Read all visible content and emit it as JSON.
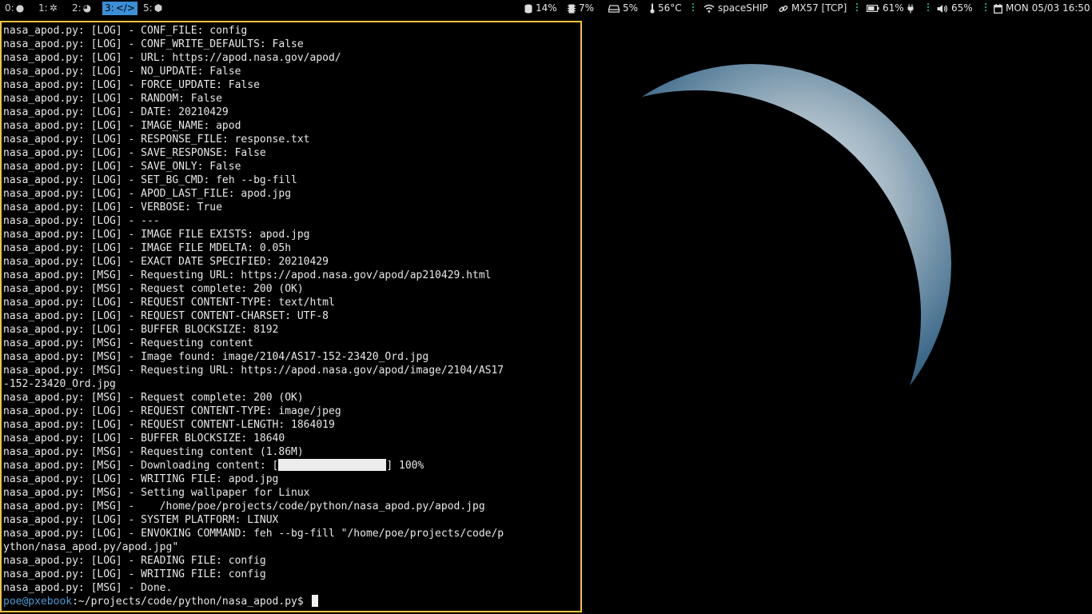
{
  "workspaces": [
    {
      "label": "0:",
      "icon": "bomb-icon",
      "active": false
    },
    {
      "label": "1:",
      "icon": "gear-icon",
      "active": false
    },
    {
      "label": "2:",
      "icon": "firefox-icon",
      "active": false
    },
    {
      "label": "3:",
      "icon": "code-icon",
      "active": true
    },
    {
      "label": "5:",
      "icon": "box-icon",
      "active": false
    }
  ],
  "status": {
    "disk": "14%",
    "memory": "7%",
    "cpu": "5%",
    "temperature": "56°C",
    "wifi": "spaceSHIP",
    "vpn": "MX57 [TCP]",
    "battery": "61%",
    "volume": "65%",
    "datetime": "MON 05/03 16:50"
  },
  "colors": {
    "accent": "#3b8fd6",
    "terminal_border": "#f5c342",
    "separator": "#2fd07a",
    "prompt": "#4a9bd8"
  },
  "terminal": {
    "lines": [
      "nasa_apod.py: [LOG] - CONF_FILE: config",
      "nasa_apod.py: [LOG] - CONF_WRITE_DEFAULTS: False",
      "nasa_apod.py: [LOG] - URL: https://apod.nasa.gov/apod/",
      "nasa_apod.py: [LOG] - NO_UPDATE: False",
      "nasa_apod.py: [LOG] - FORCE_UPDATE: False",
      "nasa_apod.py: [LOG] - RANDOM: False",
      "nasa_apod.py: [LOG] - DATE: 20210429",
      "nasa_apod.py: [LOG] - IMAGE_NAME: apod",
      "nasa_apod.py: [LOG] - RESPONSE_FILE: response.txt",
      "nasa_apod.py: [LOG] - SAVE_RESPONSE: False",
      "nasa_apod.py: [LOG] - SAVE_ONLY: False",
      "nasa_apod.py: [LOG] - SET_BG_CMD: feh --bg-fill",
      "nasa_apod.py: [LOG] - APOD_LAST_FILE: apod.jpg",
      "nasa_apod.py: [LOG] - VERBOSE: True",
      "nasa_apod.py: [LOG] - ---",
      "nasa_apod.py: [LOG] - IMAGE FILE EXISTS: apod.jpg",
      "nasa_apod.py: [LOG] - IMAGE FILE MDELTA: 0.05h",
      "nasa_apod.py: [LOG] - EXACT DATE SPECIFIED: 20210429",
      "nasa_apod.py: [MSG] - Requesting URL: https://apod.nasa.gov/apod/ap210429.html",
      "nasa_apod.py: [MSG] - Request complete: 200 (OK)",
      "nasa_apod.py: [LOG] - REQUEST CONTENT-TYPE: text/html",
      "nasa_apod.py: [LOG] - REQUEST CONTENT-CHARSET: UTF-8",
      "nasa_apod.py: [LOG] - BUFFER BLOCKSIZE: 8192",
      "nasa_apod.py: [MSG] - Requesting content",
      "nasa_apod.py: [MSG] - Image found: image/2104/AS17-152-23420_Ord.jpg",
      "nasa_apod.py: [MSG] - Requesting URL: https://apod.nasa.gov/apod/image/2104/AS17",
      "-152-23420_Ord.jpg",
      "nasa_apod.py: [MSG] - Request complete: 200 (OK)",
      "nasa_apod.py: [LOG] - REQUEST CONTENT-TYPE: image/jpeg",
      "nasa_apod.py: [LOG] - REQUEST CONTENT-LENGTH: 1864019",
      "nasa_apod.py: [LOG] - BUFFER BLOCKSIZE: 18640",
      "nasa_apod.py: [MSG] - Requesting content (1.86M)"
    ],
    "download": {
      "prefix": "nasa_apod.py: [MSG] - Downloading content: [",
      "suffix": "] 100%",
      "progress": 1.0
    },
    "lines_after": [
      "nasa_apod.py: [LOG] - WRITING FILE: apod.jpg",
      "nasa_apod.py: [MSG] - Setting wallpaper for Linux",
      "nasa_apod.py: [MSG] -    /home/poe/projects/code/python/nasa_apod.py/apod.jpg",
      "nasa_apod.py: [LOG] - SYSTEM PLATFORM: LINUX",
      "nasa_apod.py: [LOG] - ENVOKING COMMAND: feh --bg-fill \"/home/poe/projects/code/p",
      "ython/nasa_apod.py/apod.jpg\"",
      "nasa_apod.py: [LOG] - READING FILE: config",
      "nasa_apod.py: [LOG] - WRITING FILE: config",
      "nasa_apod.py: [MSG] - Done."
    ],
    "prompt_user": "poe@pxebook",
    "prompt_path": ":~/projects/code/python/nasa_apod.py$ "
  }
}
